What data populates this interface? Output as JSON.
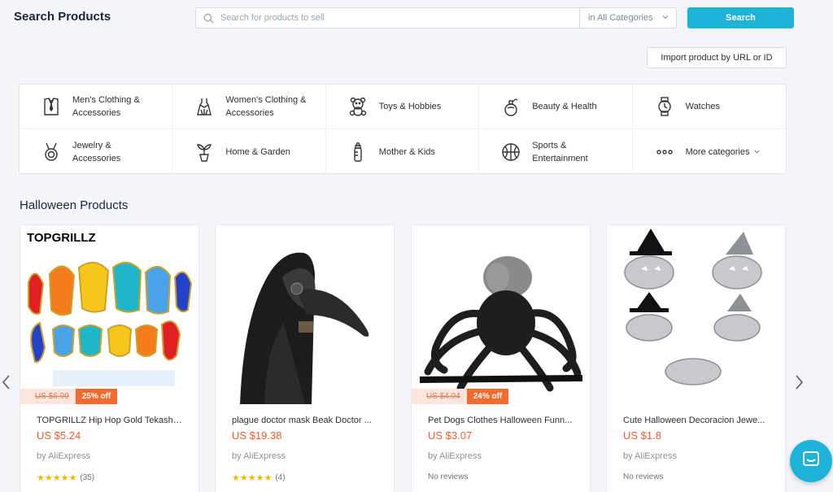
{
  "header": {
    "title": "Search Products",
    "search_placeholder": "Search for products to sell",
    "category_select": "in All Categories",
    "search_button": "Search"
  },
  "import_button": "Import product by URL or ID",
  "categories": [
    {
      "label": "Men's Clothing & Accessories",
      "icon": "shirt-icon"
    },
    {
      "label": "Women's Clothing & Accessories",
      "icon": "dress-icon"
    },
    {
      "label": "Toys & Hobbies",
      "icon": "teddy-bear-icon"
    },
    {
      "label": "Beauty & Health",
      "icon": "perfume-icon"
    },
    {
      "label": "Watches",
      "icon": "watch-icon"
    },
    {
      "label": "Jewelry & Accessories",
      "icon": "necklace-icon"
    },
    {
      "label": "Home & Garden",
      "icon": "plant-icon"
    },
    {
      "label": "Mother & Kids",
      "icon": "baby-bottle-icon"
    },
    {
      "label": "Sports & Entertainment",
      "icon": "ball-icon"
    },
    {
      "label": "More categories",
      "icon": "more-dots-icon"
    }
  ],
  "section_title": "Halloween Products",
  "products": [
    {
      "title": "TOPGRILLZ Hip Hop Gold Tekashi...",
      "price": "US $5.24",
      "seller": "by AliExpress",
      "stars": "★★★★★",
      "reviews": "(35)",
      "old_price": "US $6.99",
      "discount": "25% off",
      "brand_text": "TOPGRILLZ",
      "image": "grillz-teeth"
    },
    {
      "title": "plague doctor mask Beak Doctor ...",
      "price": "US $19.38",
      "seller": "by AliExpress",
      "stars": "★★★★★",
      "reviews": "(4)",
      "image": "plague-doctor-mask"
    },
    {
      "title": "Pet Dogs Clothes Halloween Funn...",
      "price": "US $3.07",
      "seller": "by AliExpress",
      "no_reviews": "No reviews",
      "old_price": "US $4.04",
      "discount": "24% off",
      "image": "dog-spider-costume"
    },
    {
      "title": "Cute Halloween Decoracion Jewe...",
      "price": "US $1.8",
      "seller": "by AliExpress",
      "no_reviews": "No reviews",
      "image": "pumpkin-rings"
    }
  ],
  "colors": {
    "accent": "#1eb3d9",
    "price": "#f25b30",
    "discount": "#f36a2e",
    "star": "#f5b400"
  }
}
